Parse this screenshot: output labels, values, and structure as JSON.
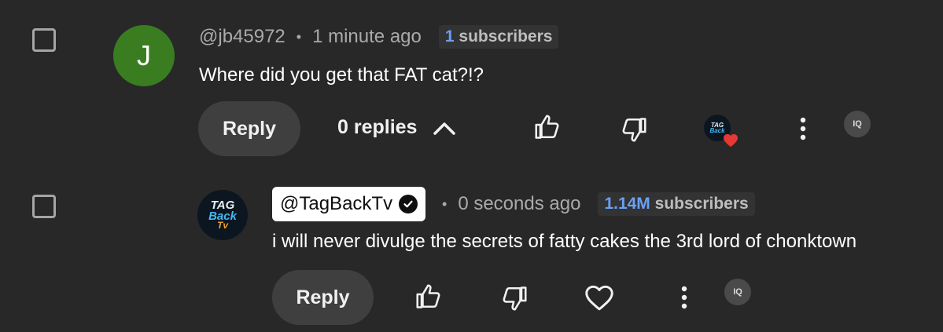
{
  "comments": [
    {
      "avatar_letter": "J",
      "author": "@jb45972",
      "time": "1 minute ago",
      "subs_count": "1",
      "subs_label": "subscribers",
      "text": "Where did you get that FAT cat?!?",
      "reply_label": "Reply",
      "replies_label": "0 replies"
    },
    {
      "author": "@TagBackTv",
      "time": "0 seconds ago",
      "subs_count": "1.14M",
      "subs_label": "subscribers",
      "text": "i will never divulge the secrets of fatty cakes the 3rd lord of chonktown",
      "reply_label": "Reply"
    }
  ],
  "channel_logo": {
    "line1": "TAG",
    "line2": "Back",
    "line3": "Tv"
  },
  "extension_badge": "IQ",
  "colors": {
    "background": "#282828",
    "avatar_green": "#3a7d21",
    "subs_blue": "#6aa0f5",
    "heart_red": "#e53935"
  },
  "icons": {
    "like": "thumbs-up-icon",
    "dislike": "thumbs-down-icon",
    "more": "more-vert-icon",
    "heart": "heart-icon",
    "chevron": "chevron-up-icon",
    "verified": "verified-check-icon"
  }
}
